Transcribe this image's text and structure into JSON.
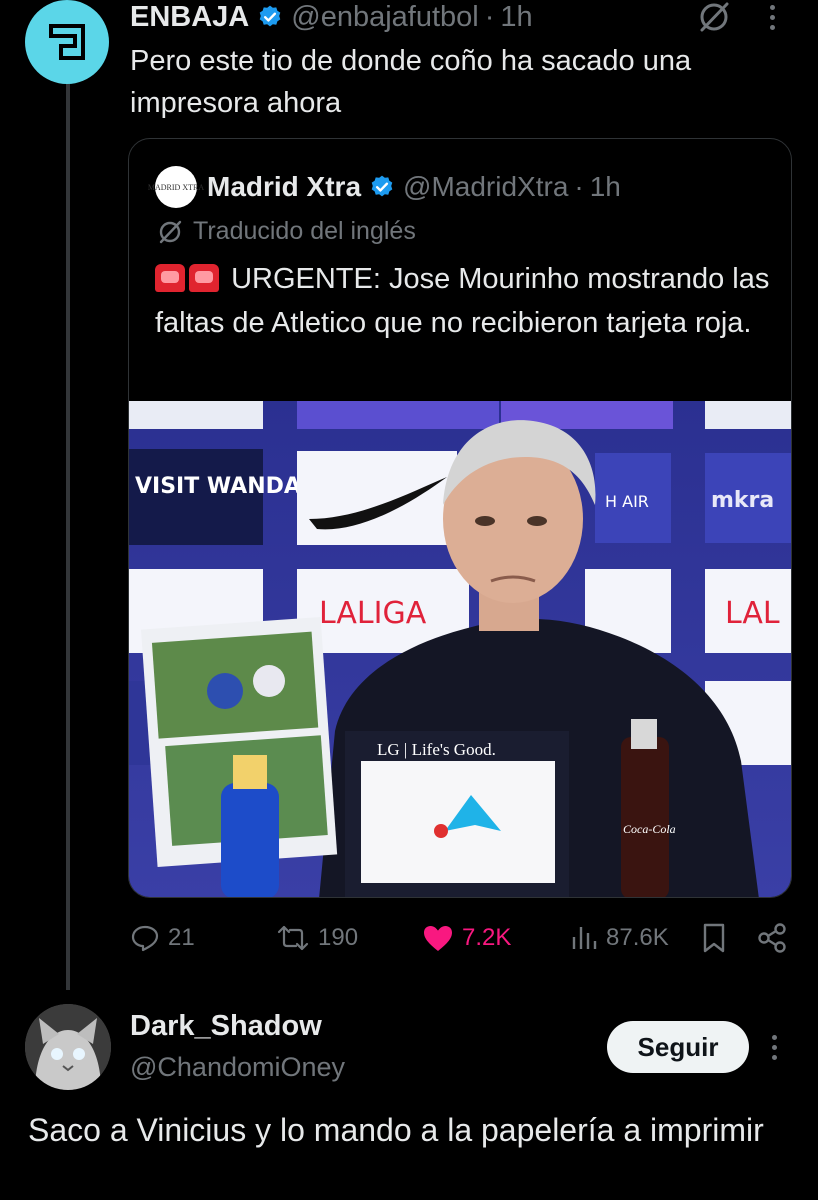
{
  "tweet": {
    "author_name": "ENBAJA",
    "author_handle": "@enbajafutbol",
    "separator": "·",
    "time": "1h",
    "text": "Pero este tio de donde coño ha sacado una impresora ahora"
  },
  "quote": {
    "author_name": "Madrid Xtra",
    "author_handle": "@MadridXtra",
    "separator": "·",
    "time": "1h",
    "avatar_text": "MADRID XTRA",
    "translated_label": "Traducido del inglés",
    "text": "URGENTE: Jose Mourinho mostrando las faltas de Atletico que no recibieron tarjeta roja.",
    "media": {
      "sponsor_1": "VISIT WANDA",
      "sponsor_2": "LALIGA",
      "sponsor_3": "LAL",
      "sponsor_4": "mkra",
      "sponsor_5": "H AIR",
      "monitor_brand": "LG | Life's Good.",
      "bottle_label": "Coca-Cola"
    }
  },
  "actions": {
    "replies": "21",
    "reposts": "190",
    "likes": "7.2K",
    "views": "87.6K"
  },
  "reply": {
    "author_name": "Dark_Shadow",
    "author_handle": "@ChandomiOney",
    "follow_label": "Seguir",
    "text": "Saco a Vinicius y lo mando a la papelería a imprimir"
  },
  "colors": {
    "background": "#000000",
    "text": "#e7e9ea",
    "muted": "#71767b",
    "verified": "#1d9bf0",
    "like": "#f91880",
    "enbaja_avatar": "#5bd6e8"
  }
}
